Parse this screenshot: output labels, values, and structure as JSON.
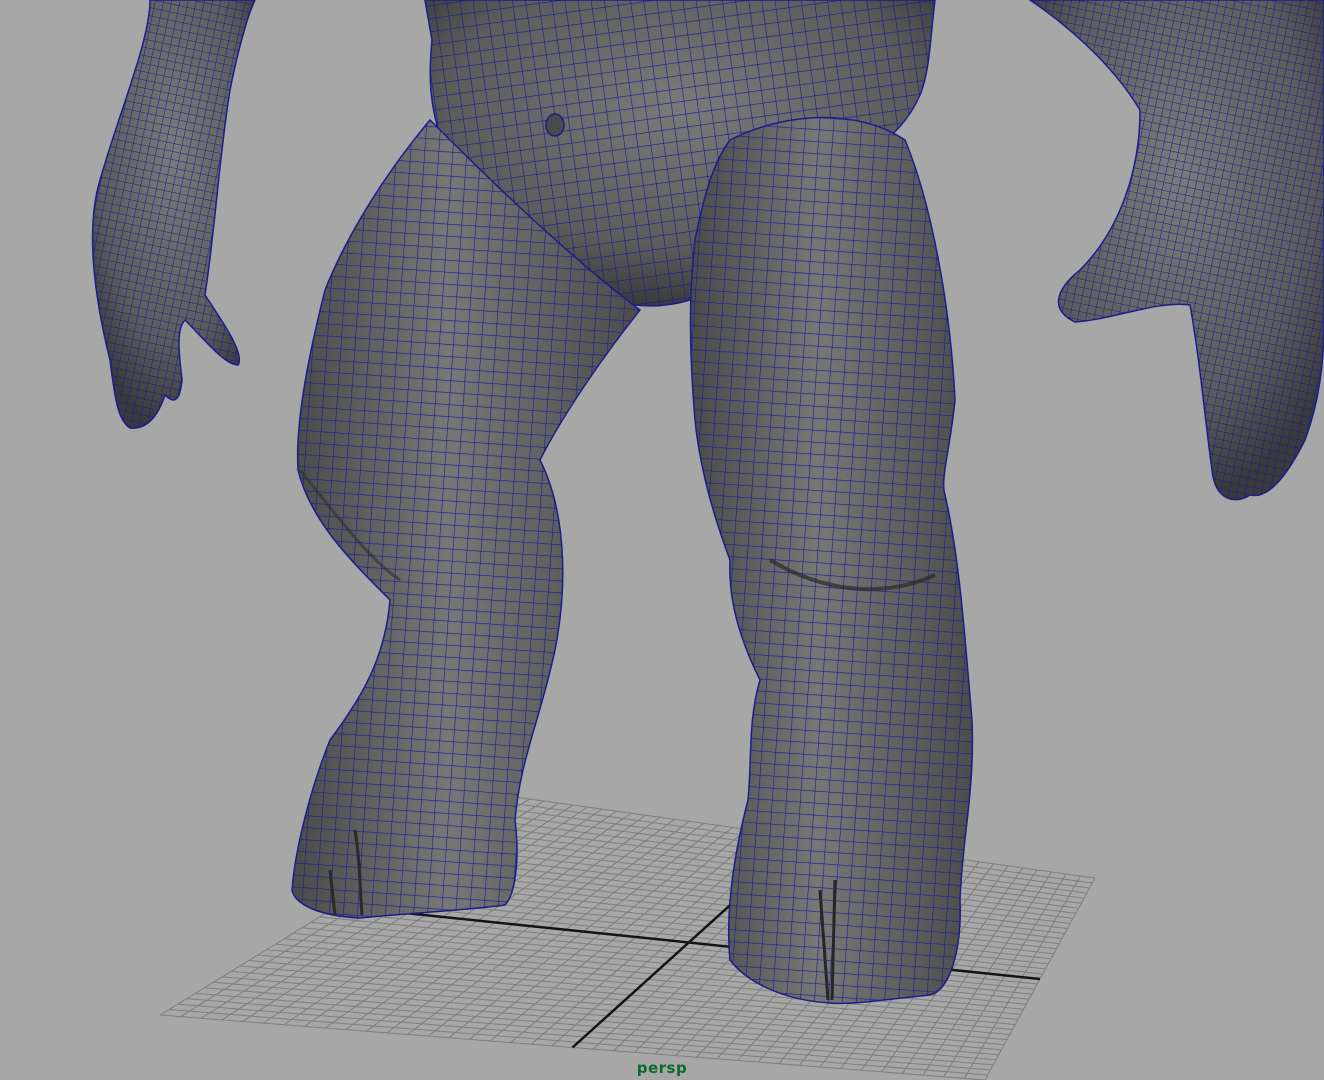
{
  "viewport": {
    "camera_label": "persp",
    "background": "#a7a7a7",
    "colors": {
      "mesh_fill": "#6d6d6d",
      "mesh_shadow": "#3f3f3f",
      "wireframe": "#1c1c8c",
      "grid_line": "#7e7e7e",
      "grid_axis": "#141414"
    }
  }
}
